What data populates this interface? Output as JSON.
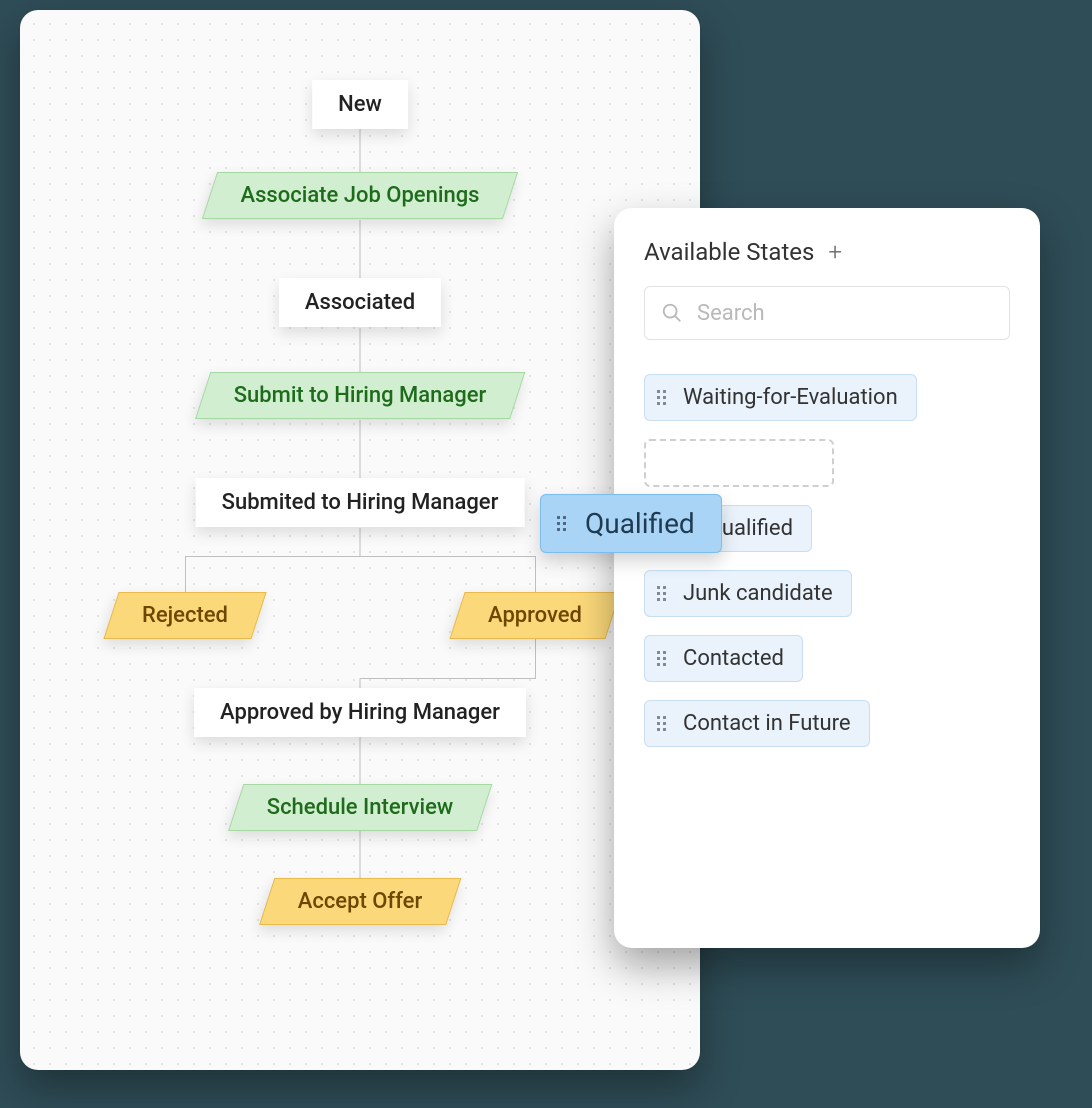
{
  "flow": {
    "nodes": {
      "new": "New",
      "associated": "Associated",
      "submitted": "Submited to Hiring Manager",
      "approved_by": "Approved by Hiring Manager"
    },
    "actions": {
      "associate": "Associate Job Openings",
      "submit": "Submit to Hiring Manager",
      "rejected": "Rejected",
      "approved": "Approved",
      "schedule": "Schedule Interview",
      "accept": "Accept Offer"
    }
  },
  "panel": {
    "title": "Available States",
    "search_placeholder": "Search",
    "dragging": "Qualified",
    "states": [
      "Waiting-for-Evaluation",
      "Unqualified",
      "Junk candidate",
      "Contacted",
      "Contact in Future"
    ]
  }
}
